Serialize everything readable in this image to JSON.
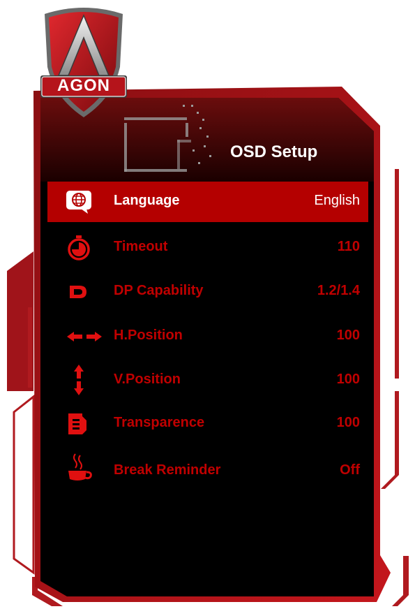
{
  "brand": {
    "logo_text": "AGON"
  },
  "header": {
    "title": "OSD Setup"
  },
  "menu": {
    "items": [
      {
        "label": "Language",
        "value": "English",
        "icon": "globe-chat-icon",
        "selected": true
      },
      {
        "label": "Timeout",
        "value": "110",
        "icon": "stopwatch-icon",
        "selected": false
      },
      {
        "label": "DP Capability",
        "value": "1.2/1.4",
        "icon": "displayport-icon",
        "selected": false
      },
      {
        "label": "H.Position",
        "value": "100",
        "icon": "horizontal-arrows-icon",
        "selected": false
      },
      {
        "label": "V.Position",
        "value": "100",
        "icon": "vertical-arrows-icon",
        "selected": false
      },
      {
        "label": "Transparence",
        "value": "100",
        "icon": "transparence-icon",
        "selected": false
      },
      {
        "label": "Break Reminder",
        "value": "Off",
        "icon": "coffee-cup-icon",
        "selected": false
      }
    ]
  },
  "colors": {
    "accent": "#c00000",
    "selected_bg": "#b40000",
    "panel_bg": "#000000",
    "frame": "#a01010"
  }
}
